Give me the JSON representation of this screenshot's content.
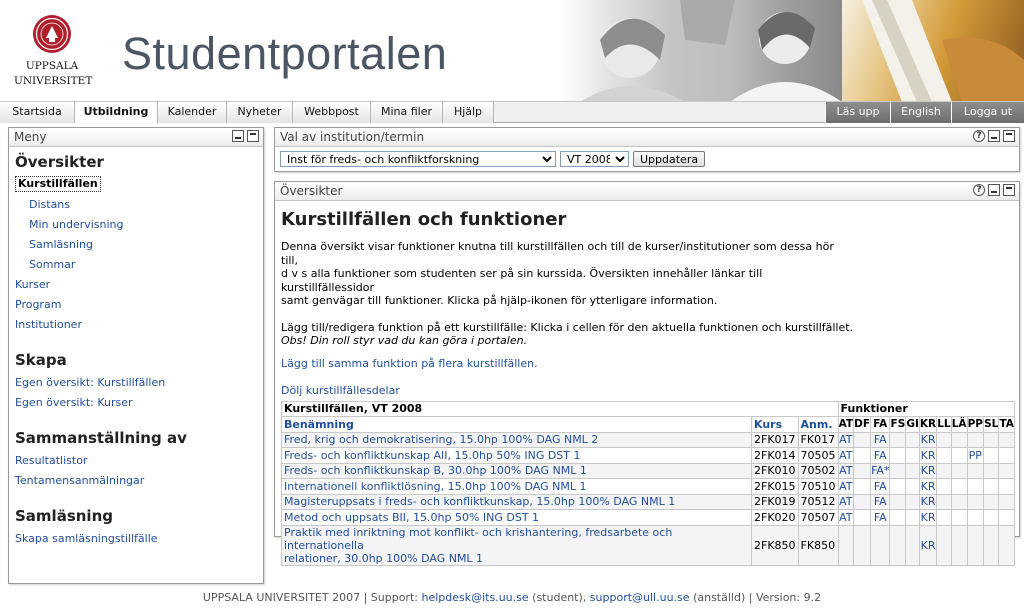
{
  "header": {
    "logo_line1": "UPPSALA",
    "logo_line2": "UNIVERSITET",
    "title": "Studentportalen"
  },
  "nav": {
    "tabs": [
      "Startsida",
      "Utbildning",
      "Kalender",
      "Nyheter",
      "Webbpost",
      "Mina filer",
      "Hjälp"
    ],
    "active_tab": "Utbildning",
    "right": [
      "Läs upp",
      "English",
      "Logga ut"
    ]
  },
  "menu": {
    "title": "Meny",
    "sections": [
      {
        "heading": "Översikter",
        "current": "Kurstillfällen",
        "sub": [
          "Distans",
          "Min undervisning",
          "Samläsning",
          "Sommar"
        ],
        "items": [
          "Kurser",
          "Program",
          "Institutioner"
        ]
      },
      {
        "heading": "Skapa",
        "items": [
          "Egen översikt: Kurstillfällen",
          "Egen översikt: Kurser"
        ]
      },
      {
        "heading": "Sammanställning av",
        "items": [
          "Resultatlistor",
          "Tentamensanmälningar"
        ]
      },
      {
        "heading": "Samläsning",
        "items": [
          "Skapa samläsningstillfälle"
        ]
      }
    ]
  },
  "selector": {
    "title": "Val av institution/termin",
    "institution": "Inst för freds- och konfliktforskning",
    "term": "VT 2008",
    "update_label": "Uppdatera"
  },
  "overview": {
    "panel_title": "Översikter",
    "heading": "Kurstillfällen och funktioner",
    "intro_lines": [
      "Denna översikt visar funktioner knutna till kurstillfällen och till de kurser/institutioner som dessa hör till,",
      "d v s alla funktioner som studenten ser på sin kurssida. Översikten innehåller länkar till kurstillfällessidor",
      "samt genvägar till funktioner. Klicka på hjälp-ikonen för ytterligare information."
    ],
    "instruction": "Lägg till/redigera funktion på ett kurstillfälle: Klicka i cellen för den aktuella funktionen och kurstillfället.",
    "note": "Obs! Din roll styr vad du kan göra i portalen.",
    "add_link": "Lägg till samma funktion på flera kurstillfällen.",
    "hide_link": "Dölj kurstillfällesdelar"
  },
  "table": {
    "caption": "Kurstillfällen, VT 2008",
    "functions_label": "Funktioner",
    "col_benamning": "Benämning",
    "col_kurs": "Kurs",
    "col_anm": "Anm.",
    "func_cols": [
      "AT",
      "DF",
      "FA",
      "FS",
      "GI",
      "KR",
      "LL",
      "LÄ",
      "PP",
      "SL",
      "TA"
    ],
    "rows": [
      {
        "name": "Fred, krig och demokratisering, 15.0hp 100% DAG NML 2",
        "kurs": "2FK017",
        "anm": "FK017",
        "f": [
          "AT",
          "",
          "FA",
          "",
          "",
          "KR",
          "",
          "",
          "",
          "",
          ""
        ]
      },
      {
        "name": "Freds- och konfliktkunskap AII, 15.0hp 50% ING DST 1",
        "kurs": "2FK014",
        "anm": "70505",
        "f": [
          "AT",
          "",
          "FA",
          "",
          "",
          "KR",
          "",
          "",
          "PP",
          "",
          ""
        ]
      },
      {
        "name": "Freds- och konfliktkunskap B, 30.0hp 100% DAG NML 1",
        "kurs": "2FK010",
        "anm": "70502",
        "f": [
          "AT",
          "",
          "FA*",
          "",
          "",
          "KR",
          "",
          "",
          "",
          "",
          ""
        ]
      },
      {
        "name": "Internationell konfliktlösning, 15.0hp 100% DAG NML 1",
        "kurs": "2FK015",
        "anm": "70510",
        "f": [
          "AT",
          "",
          "FA",
          "",
          "",
          "KR",
          "",
          "",
          "",
          "",
          ""
        ]
      },
      {
        "name": "Magisteruppsats i freds- och konfliktkunskap, 15.0hp 100% DAG NML 1",
        "kurs": "2FK019",
        "anm": "70512",
        "f": [
          "AT",
          "",
          "FA",
          "",
          "",
          "KR",
          "",
          "",
          "",
          "",
          ""
        ]
      },
      {
        "name": "Metod och uppsats BII, 15.0hp 50% ING DST 1",
        "kurs": "2FK020",
        "anm": "70507",
        "f": [
          "AT",
          "",
          "FA",
          "",
          "",
          "KR",
          "",
          "",
          "",
          "",
          ""
        ]
      },
      {
        "name": "Praktik med inriktning mot konflikt- och krishantering, fredsarbete och internationella",
        "name2": "relationer, 30.0hp 100% DAG NML 1",
        "kurs": "2FK850",
        "anm": "FK850",
        "f": [
          "",
          "",
          "",
          "",
          "",
          "KR",
          "",
          "",
          "",
          "",
          ""
        ]
      }
    ]
  },
  "footer": {
    "org": "UPPSALA UNIVERSITET 2007",
    "support_label": "Support:",
    "email1": "helpdesk@its.uu.se",
    "role1": "(student),",
    "email2": "support@ull.uu.se",
    "role2": "(anställd)",
    "version": "Version: 9.2"
  },
  "colors": {
    "link": "#1f4e9c",
    "title_gray": "#4b5563",
    "nav_dark": "#7a7a7a"
  }
}
